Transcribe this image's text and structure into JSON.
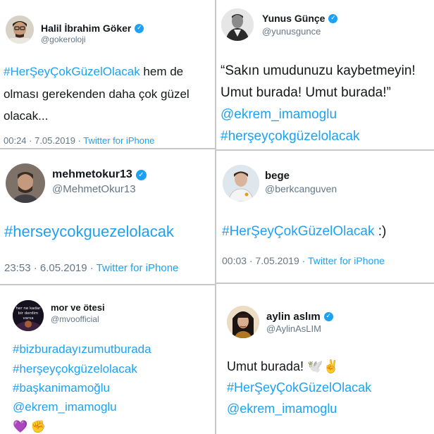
{
  "tweets": [
    {
      "name": "Halil İbrahim Göker",
      "handle": "@gokeroloji",
      "body": {
        "l1_link": "#HerŞeyÇokGüzelOlacak",
        "l1_rest": " hem de",
        "l2": "olması gerekenden daha çok güzel",
        "l3": "olacak..."
      },
      "meta_time": "00:24 · 7.05.2019 · ",
      "meta_source": "Twitter for iPhone"
    },
    {
      "name": "Yunus Günçe",
      "handle": "@yunusgunce",
      "body": {
        "l1": "“Sakın umudunuzu kaybetmeyin!",
        "l2": "Umut burada! Umut burada!”",
        "l3": "@ekrem_imamoglu",
        "l4": "#herşeyçokgüzelolacak"
      }
    },
    {
      "name": "mehmetokur13",
      "handle": "@MehmetOkur13",
      "body": {
        "l1": "#herseycokguezelolacak"
      },
      "meta_time": "23:53 · 6.05.2019 · ",
      "meta_source": "Twitter for iPhone"
    },
    {
      "name": "bege",
      "handle": "@berkcanguven",
      "body": {
        "l1_link": "#HerŞeyÇokGüzelOlacak",
        "l1_rest": " :)"
      },
      "meta_time": "00:03 · 7.05.2019 · ",
      "meta_source": "Twitter for iPhone"
    },
    {
      "name": "mor ve ötesi",
      "handle": "@mvoofficial",
      "avatar_caption": "her ne kadar bir derdim varsa",
      "body": {
        "l1": "#bizburadayızumutburada",
        "l2": "#herşeyçokgüzelolacak",
        "l3": "#başkanimamoğlu",
        "l4": "@ekrem_imamoglu",
        "l5": "💜 ✊"
      }
    },
    {
      "name": "aylin aslım",
      "handle": "@AylinAsLIM",
      "body": {
        "l1": "Umut burada! 🕊️✌️",
        "l2": "#HerŞeyÇokGüzelOlacak",
        "l3": "@ekrem_imamoglu"
      }
    }
  ],
  "colors": {
    "link": "#1da1f2",
    "muted": "#657786",
    "text": "#14171a",
    "verified": "#1da1f2"
  },
  "icons": {
    "verified": "verified-badge-icon"
  }
}
